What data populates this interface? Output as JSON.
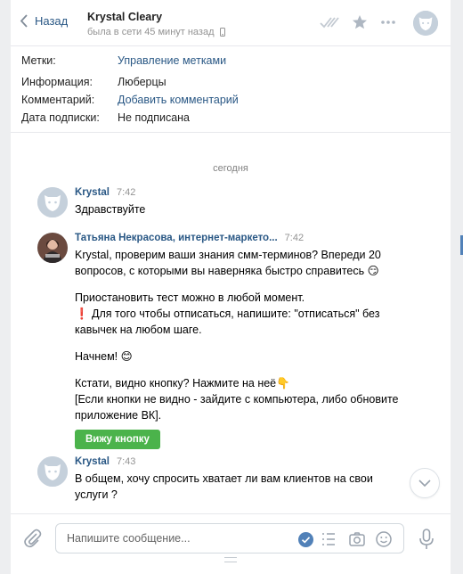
{
  "header": {
    "back_label": "Назад",
    "name": "Krystal Cleary",
    "status": "была в сети 45 минут назад"
  },
  "info": {
    "rows": [
      {
        "label": "Метки:",
        "value": "Управление метками",
        "link": true
      },
      {
        "label": "Информация:",
        "value": "Люберцы",
        "link": false
      },
      {
        "label": "Комментарий:",
        "value": "Добавить комментарий",
        "link": true
      },
      {
        "label": "Дата подписки:",
        "value": "Не подписана",
        "link": false
      }
    ]
  },
  "date_separator": "сегодня",
  "messages": [
    {
      "author": "Krystal",
      "time": "7:42",
      "lines": [
        "Здравствуйте"
      ]
    },
    {
      "author": "Татьяна Некрасова, интернет-маркето...",
      "time": "7:42",
      "paragraphs": [
        [
          "Krystal, проверим ваши знания смм-терминов? Впереди 20",
          "вопросов, с которыми вы наверняка быстро справитесь 😏"
        ],
        [
          "Приостановить тест можно в любой момент.",
          "❗ Для того чтобы отписаться, напишите: \"отписаться\" без",
          "кавычек на любом шаге."
        ],
        [
          "Начнем! 😊"
        ],
        [
          "Кстати, видно кнопку? Нажмите на неё👇",
          "[Если кнопки не видно - зайдите с компьютера, либо обновите",
          "приложение ВК]."
        ]
      ],
      "button_label": "Вижу кнопку"
    },
    {
      "author": "Krystal",
      "time": "7:43",
      "lines": [
        "В общем, хочу спросить хватает ли вам клиентов на свои",
        "услуги ?"
      ]
    }
  ],
  "composer": {
    "placeholder": "Напишите сообщение..."
  },
  "colors": {
    "link": "#2a5885",
    "button_green": "#4bb34b",
    "accent": "#5181b8"
  }
}
